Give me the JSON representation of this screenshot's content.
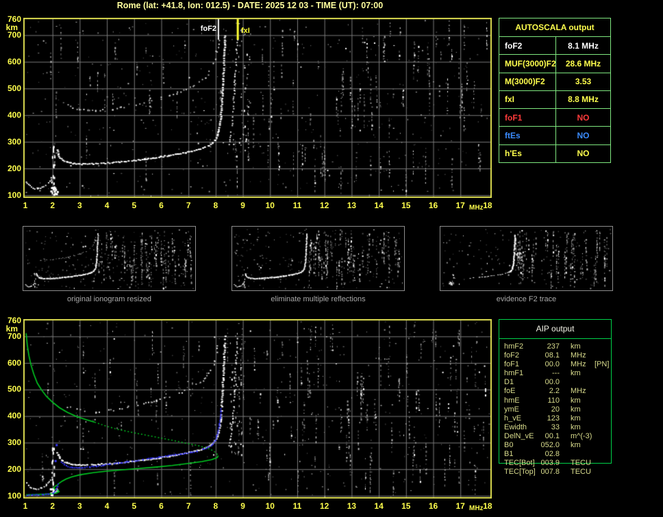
{
  "title": "Rome (lat: +41.8, lon: 012.5) - DATE: 2025 12 03 - TIME (UT): 07:00",
  "colors": {
    "background": "#000000",
    "axis_label": "#ffff4d",
    "title": "#ffff9e",
    "plot_border": "#dcdc50",
    "grid": "#7b7b7b",
    "trace_white": "#ffffff",
    "second_hop_gray": "#c9c9c9",
    "profile_green": "#00cc22",
    "fit_blue": "#2b2bf0",
    "autoscala_border": "#7fe87f",
    "aip_border": "#00d24a",
    "aip_text": "#d8db8c",
    "aip_header": "#f2f2e6",
    "caption_gray": "#a9a9a9",
    "thumb_border": "#8d8d8d",
    "marker_foF2": "#ffffff",
    "marker_fxI": "#ffff33"
  },
  "autoscala_table": {
    "title": "AUTOSCALA output",
    "rows": [
      {
        "label": "foF2",
        "value": "8.1 MHz",
        "color": "#ffffff"
      },
      {
        "label": "MUF(3000)F2",
        "value": "28.6 MHz",
        "color": "#ffff4d"
      },
      {
        "label": "M(3000)F2",
        "value": "3.53",
        "color": "#ffff4d"
      },
      {
        "label": "fxI",
        "value": "8.8 MHz",
        "color": "#ffff4d"
      },
      {
        "label": "foF1",
        "value": "NO",
        "color": "#ff3b3b"
      },
      {
        "label": "ftEs",
        "value": "NO",
        "color": "#3b8cff"
      },
      {
        "label": "h'Es",
        "value": "NO",
        "color": "#ffff4d"
      }
    ]
  },
  "aip_table": {
    "title": "AIP output",
    "rows": [
      {
        "label": "hmF2",
        "value": "237",
        "unit": "km",
        "extra": ""
      },
      {
        "label": "foF2",
        "value": "08.1",
        "unit": "MHz",
        "extra": ""
      },
      {
        "label": "foF1",
        "value": "00.0",
        "unit": "MHz",
        "extra": "[PN]"
      },
      {
        "label": "hmF1",
        "value": "---",
        "unit": "km",
        "extra": ""
      },
      {
        "label": "D1",
        "value": "00.0",
        "unit": "",
        "extra": ""
      },
      {
        "label": "foE",
        "value": "2.2",
        "unit": "MHz",
        "extra": ""
      },
      {
        "label": "hmE",
        "value": "110",
        "unit": "km",
        "extra": ""
      },
      {
        "label": "ymE",
        "value": "20",
        "unit": "km",
        "extra": ""
      },
      {
        "label": "h_vE",
        "value": "123",
        "unit": "km",
        "extra": ""
      },
      {
        "label": "Ewidth",
        "value": "33",
        "unit": "km",
        "extra": ""
      },
      {
        "label": "DelN_vE",
        "value": "00.1",
        "unit": "m^(-3)",
        "extra": ""
      },
      {
        "label": "B0",
        "value": "052.0",
        "unit": "km",
        "extra": ""
      },
      {
        "label": "B1",
        "value": "02.8",
        "unit": "",
        "extra": ""
      },
      {
        "label": "TEC[Bot]",
        "value": "003.9",
        "unit": "TECU",
        "extra": ""
      },
      {
        "label": "TEC[Top]",
        "value": "007.8",
        "unit": "TECU",
        "extra": ""
      }
    ]
  },
  "thumbnails": [
    {
      "caption": "original ionogram resized"
    },
    {
      "caption": "eliminate multiple reflections"
    },
    {
      "caption": "evidence F2 trace"
    }
  ],
  "chart_data": {
    "type": "scatter",
    "xlabel": "MHz",
    "ylabel": "km",
    "xlim": [
      1,
      18
    ],
    "ylim": [
      100,
      760
    ],
    "x_ticks": [
      1,
      2,
      3,
      4,
      5,
      6,
      7,
      8,
      9,
      10,
      11,
      12,
      13,
      14,
      15,
      16,
      17,
      18
    ],
    "y_ticks": [
      760,
      700,
      600,
      500,
      400,
      300,
      200,
      100
    ],
    "grid": true,
    "markers": {
      "foF2_label": "foF2",
      "foF2_MHz": 8.1,
      "fxI_label": "fxI",
      "fxI_MHz": 8.8
    },
    "traces": {
      "low_dip": [
        [
          1.02,
          152
        ],
        [
          1.1,
          141
        ],
        [
          1.2,
          133
        ],
        [
          1.33,
          128
        ],
        [
          1.47,
          128
        ],
        [
          1.6,
          133
        ],
        [
          1.72,
          140
        ],
        [
          1.83,
          150
        ],
        [
          1.92,
          162
        ],
        [
          1.98,
          175
        ]
      ],
      "first_hop": [
        [
          2.13,
          272
        ],
        [
          2.18,
          255
        ],
        [
          2.25,
          243
        ],
        [
          2.35,
          233
        ],
        [
          2.5,
          226
        ],
        [
          2.7,
          221
        ],
        [
          2.95,
          219
        ],
        [
          3.25,
          219
        ],
        [
          3.55,
          220
        ],
        [
          3.85,
          222
        ],
        [
          4.15,
          224
        ],
        [
          4.45,
          227
        ],
        [
          4.75,
          230
        ],
        [
          5.05,
          233
        ],
        [
          5.35,
          237
        ],
        [
          5.65,
          241
        ],
        [
          5.95,
          246
        ],
        [
          6.25,
          251
        ],
        [
          6.55,
          256
        ],
        [
          6.85,
          262
        ],
        [
          7.1,
          268
        ],
        [
          7.35,
          274
        ],
        [
          7.55,
          281
        ],
        [
          7.72,
          289
        ],
        [
          7.85,
          298
        ],
        [
          7.95,
          310
        ],
        [
          8.02,
          324
        ],
        [
          8.08,
          342
        ],
        [
          8.12,
          364
        ],
        [
          8.15,
          390
        ],
        [
          8.18,
          422
        ],
        [
          8.2,
          458
        ],
        [
          8.22,
          498
        ],
        [
          8.24,
          540
        ],
        [
          8.26,
          584
        ],
        [
          8.28,
          628
        ],
        [
          8.3,
          670
        ],
        [
          8.32,
          705
        ]
      ],
      "x_mode": [
        [
          8.48,
          292
        ],
        [
          8.52,
          318
        ],
        [
          8.56,
          352
        ],
        [
          8.6,
          394
        ],
        [
          8.63,
          442
        ],
        [
          8.66,
          494
        ],
        [
          8.69,
          548
        ],
        [
          8.72,
          602
        ],
        [
          8.75,
          652
        ],
        [
          8.78,
          695
        ]
      ],
      "second_hop": [
        [
          2.55,
          438
        ],
        [
          2.75,
          430
        ],
        [
          3.0,
          424
        ],
        [
          3.3,
          420
        ],
        [
          3.6,
          419
        ],
        [
          3.9,
          421
        ],
        [
          4.2,
          425
        ],
        [
          4.5,
          430
        ],
        [
          4.8,
          436
        ],
        [
          5.1,
          443
        ],
        [
          5.4,
          450
        ],
        [
          5.7,
          458
        ],
        [
          6.0,
          467
        ],
        [
          6.3,
          477
        ],
        [
          6.6,
          488
        ],
        [
          6.9,
          500
        ],
        [
          7.15,
          513
        ],
        [
          7.4,
          528
        ],
        [
          7.6,
          545
        ],
        [
          7.75,
          564
        ],
        [
          7.87,
          586
        ],
        [
          7.95,
          612
        ],
        [
          8.02,
          642
        ],
        [
          8.08,
          672
        ]
      ],
      "profile_green_upper_solid": [
        [
          1.03,
          712
        ],
        [
          1.07,
          668
        ],
        [
          1.13,
          628
        ],
        [
          1.21,
          592
        ],
        [
          1.31,
          558
        ],
        [
          1.44,
          524
        ],
        [
          1.6,
          498
        ],
        [
          1.78,
          474
        ],
        [
          1.98,
          454
        ],
        [
          2.25,
          432
        ],
        [
          2.55,
          414
        ],
        [
          2.9,
          398
        ],
        [
          3.25,
          386
        ],
        [
          3.55,
          377
        ]
      ],
      "profile_green_upper_dotted": [
        [
          3.55,
          377
        ],
        [
          3.95,
          363
        ],
        [
          4.4,
          350
        ],
        [
          4.9,
          339
        ],
        [
          5.4,
          329
        ],
        [
          5.9,
          319
        ],
        [
          6.4,
          309
        ],
        [
          6.9,
          298
        ],
        [
          7.35,
          289
        ],
        [
          7.7,
          279
        ],
        [
          7.92,
          269
        ],
        [
          8.04,
          259
        ],
        [
          8.09,
          251
        ]
      ],
      "profile_green_lower_solid": [
        [
          8.09,
          251
        ],
        [
          8.06,
          244
        ],
        [
          7.85,
          236
        ],
        [
          7.5,
          229
        ],
        [
          7.0,
          222
        ],
        [
          6.4,
          214
        ],
        [
          5.8,
          208
        ],
        [
          5.2,
          203
        ],
        [
          4.6,
          198
        ],
        [
          4.0,
          193
        ],
        [
          3.5,
          187
        ],
        [
          3.0,
          179
        ],
        [
          2.7,
          171
        ],
        [
          2.5,
          163
        ],
        [
          2.35,
          155
        ],
        [
          2.24,
          147
        ],
        [
          2.18,
          141
        ],
        [
          2.1,
          136
        ],
        [
          2.04,
          130
        ],
        [
          2.08,
          125
        ],
        [
          2.18,
          121
        ],
        [
          2.24,
          116
        ],
        [
          2.16,
          111
        ],
        [
          2.02,
          108
        ],
        [
          1.8,
          106
        ],
        [
          1.5,
          105
        ],
        [
          1.2,
          104
        ],
        [
          1.03,
          104
        ]
      ],
      "fit_blue_E": [
        [
          1.05,
          104
        ],
        [
          1.25,
          105
        ],
        [
          1.45,
          106
        ],
        [
          1.65,
          107
        ],
        [
          1.85,
          109
        ],
        [
          2.0,
          112
        ],
        [
          2.06,
          118
        ],
        [
          2.11,
          127
        ],
        [
          2.16,
          139
        ],
        [
          2.2,
          152
        ]
      ],
      "fit_blue_F": [
        [
          2.3,
          230
        ],
        [
          2.42,
          219
        ],
        [
          2.55,
          212
        ],
        [
          2.7,
          209
        ],
        [
          2.9,
          208
        ],
        [
          3.1,
          209
        ],
        [
          3.35,
          211
        ],
        [
          3.6,
          214
        ],
        [
          3.85,
          218
        ],
        [
          4.1,
          222
        ],
        [
          4.4,
          226
        ],
        [
          4.7,
          230
        ],
        [
          5.0,
          233
        ],
        [
          5.3,
          238
        ],
        [
          5.6,
          243
        ],
        [
          5.9,
          248
        ],
        [
          6.2,
          252
        ],
        [
          6.5,
          257
        ],
        [
          6.8,
          261
        ],
        [
          7.05,
          265
        ],
        [
          7.3,
          270
        ],
        [
          7.55,
          278
        ],
        [
          7.75,
          287
        ],
        [
          7.88,
          297
        ],
        [
          7.97,
          311
        ],
        [
          8.03,
          328
        ],
        [
          8.08,
          350
        ],
        [
          8.12,
          376
        ],
        [
          8.15,
          402
        ],
        [
          8.17,
          422
        ],
        [
          8.18,
          434
        ]
      ],
      "fit_blue_isolated": [
        [
          2.1,
          232
        ],
        [
          2.14,
          292
        ]
      ]
    },
    "noise_seeds": {
      "top": 7,
      "top_left": 8,
      "bottom": 13,
      "bottom_left": 14,
      "thumbs": [
        21,
        22,
        23
      ]
    }
  }
}
